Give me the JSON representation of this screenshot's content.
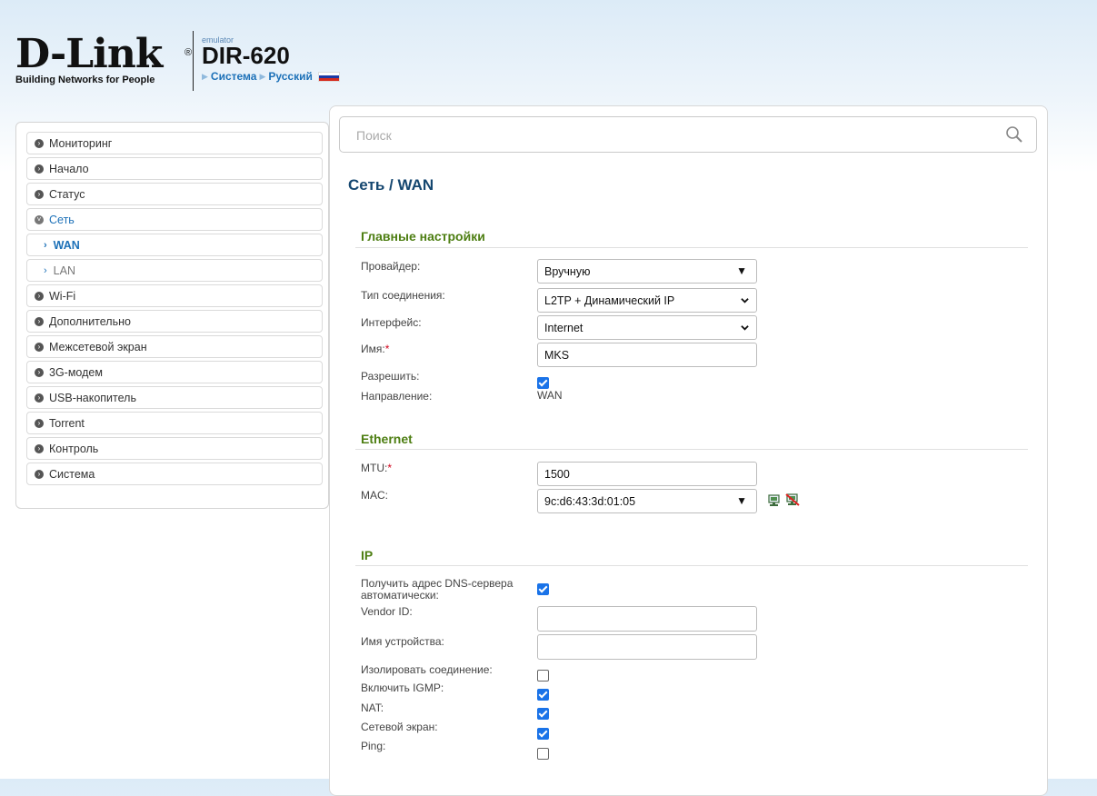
{
  "header": {
    "logo_text": "D-Link",
    "logo_reg": "®",
    "tagline": "Building Networks for People",
    "emulator_label": "emulator",
    "model": "DIR-620",
    "crumb_system": "Система",
    "crumb_language": "Русский"
  },
  "sidebar": {
    "items": [
      {
        "label": "Мониторинг"
      },
      {
        "label": "Начало"
      },
      {
        "label": "Статус"
      },
      {
        "label": "Сеть"
      },
      {
        "label": "WAN"
      },
      {
        "label": "LAN"
      },
      {
        "label": "Wi-Fi"
      },
      {
        "label": "Дополнительно"
      },
      {
        "label": "Межсетевой экран"
      },
      {
        "label": "3G-модем"
      },
      {
        "label": "USB-накопитель"
      },
      {
        "label": "Torrent"
      },
      {
        "label": "Контроль"
      },
      {
        "label": "Система"
      }
    ]
  },
  "search": {
    "placeholder": "Поиск"
  },
  "page": {
    "title_part1": "Сеть /",
    "title_part2": "WAN"
  },
  "main_settings": {
    "title": "Главные настройки",
    "provider_label": "Провайдер:",
    "provider_value": "Вручную",
    "conn_type_label": "Тип соединения:",
    "conn_type_value": "L2TP + Динамический IP",
    "interface_label": "Интерфейс:",
    "interface_value": "Internet",
    "name_label": "Имя:",
    "name_required": "*",
    "name_value": "MKS",
    "enable_label": "Разрешить:",
    "enable_checked": true,
    "direction_label": "Направление:",
    "direction_value": "WAN"
  },
  "ethernet": {
    "title": "Ethernet",
    "mtu_label": "MTU:",
    "mtu_required": "*",
    "mtu_value": "1500",
    "mac_label": "MAC:",
    "mac_value": "9c:d6:43:3d:01:05"
  },
  "ip": {
    "title": "IP",
    "dns_auto_label_1": "Получить адрес DNS-сервера",
    "dns_auto_label_2": "автоматически:",
    "dns_auto_checked": true,
    "vendor_id_label": "Vendor ID:",
    "vendor_id_value": "",
    "device_name_label": "Имя устройства:",
    "device_name_value": "",
    "isolate_label": "Изолировать соединение:",
    "isolate_checked": false,
    "igmp_label": "Включить IGMP:",
    "igmp_checked": true,
    "nat_label": "NAT:",
    "nat_checked": true,
    "firewall_label": "Сетевой экран:",
    "firewall_checked": true,
    "ping_label": "Ping:",
    "ping_checked": false
  },
  "colors": {
    "accent_blue": "#1d71b8",
    "title_navy": "#154770",
    "section_green": "#4d7e12",
    "checkbox_blue": "#1a73e8",
    "required_red": "#d0021b"
  },
  "icons": {
    "search": "magnifier-icon",
    "mac_clone": "computer-icon",
    "mac_clear": "computer-crossed-icon"
  }
}
